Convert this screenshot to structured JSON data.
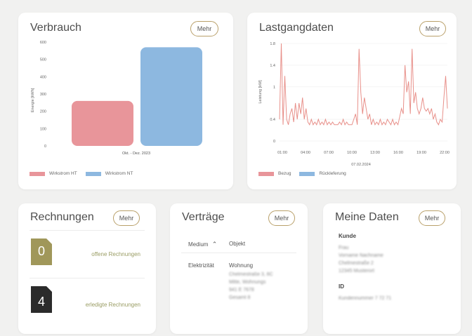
{
  "colors": {
    "accent": "#b9a06a",
    "ht": "#e8959a",
    "nt": "#8db8e0",
    "line": "#e8908a",
    "doc_open": "#a0975a",
    "doc_done": "#2b2b2b"
  },
  "verbrauch": {
    "title": "Verbrauch",
    "mehr": "Mehr",
    "chart_data": {
      "type": "bar",
      "categories": [
        "Okt. - Dez. 2023"
      ],
      "series": [
        {
          "name": "Wirkstrom HT",
          "values": [
            260
          ]
        },
        {
          "name": "Wirkstrom NT",
          "values": [
            570
          ]
        }
      ],
      "ylabel": "Energie [kWh]",
      "ylim": [
        0,
        600
      ],
      "yticks": [
        "0",
        "100",
        "200",
        "300",
        "400",
        "500",
        "600"
      ]
    }
  },
  "lastgang": {
    "title": "Lastgangdaten",
    "mehr": "Mehr",
    "chart_data": {
      "type": "line",
      "ylabel": "Leistung [kW]",
      "xlabel": "07.02.2024",
      "ylim": [
        0,
        1.8
      ],
      "yticks": [
        "0",
        "0.4",
        "1",
        "1.4",
        "1.8"
      ],
      "xticks": [
        "01:00",
        "04:00",
        "07:00",
        "10:00",
        "13:00",
        "16:00",
        "19:00",
        "22:00"
      ],
      "series": [
        {
          "name": "Bezug",
          "values": [
            0.4,
            1.8,
            0.3,
            1.2,
            0.4,
            0.3,
            0.5,
            0.6,
            0.35,
            0.7,
            0.4,
            0.7,
            0.5,
            0.8,
            0.4,
            0.6,
            0.35,
            0.3,
            0.4,
            0.3,
            0.35,
            0.3,
            0.4,
            0.3,
            0.35,
            0.3,
            0.4,
            0.3,
            0.35,
            0.3,
            0.35,
            0.3,
            0.3,
            0.3,
            0.35,
            0.3,
            0.4,
            0.3,
            0.35,
            0.3,
            0.3,
            0.3,
            0.4,
            0.5,
            0.3,
            1.7,
            0.9,
            0.5,
            0.8,
            0.6,
            0.4,
            0.5,
            0.3,
            0.4,
            0.3,
            0.35,
            0.3,
            0.4,
            0.3,
            0.35,
            0.3,
            0.4,
            0.35,
            0.3,
            0.4,
            0.3,
            0.35,
            0.3,
            0.45,
            0.6,
            0.5,
            1.4,
            0.9,
            1.1,
            0.5,
            1.7,
            0.7,
            0.9,
            0.6,
            0.5,
            0.6,
            0.8,
            0.6,
            0.55,
            0.6,
            0.5,
            0.6,
            0.4,
            0.5,
            0.35,
            0.3,
            0.4,
            0.35,
            0.8,
            1.2,
            0.6
          ]
        },
        {
          "name": "Rückleferung",
          "values": []
        }
      ]
    }
  },
  "rechnungen": {
    "title": "Rechnungen",
    "mehr": "Mehr",
    "open_count": "0",
    "open_label": "offene Rechnungen",
    "done_count": "4",
    "done_label": "erledigte Rechnungen"
  },
  "vertraege": {
    "title": "Verträge",
    "mehr": "Mehr",
    "col_medium": "Medium",
    "col_objekt": "Objekt",
    "row_medium": "Elektrizität",
    "row_objekt_line1": "Wohnung",
    "row_objekt_blurred": [
      "Chelmestraße 3, 8C",
      "Mitte, Wohnungs",
      "941 E 7678",
      "Gesamt 8"
    ]
  },
  "meine_daten": {
    "title": "Meine Daten",
    "mehr": "Mehr",
    "kunde_label": "Kunde",
    "kunde_blurred": [
      "Frau",
      "Vorname Nachname",
      "Chelmestraße 2",
      "12345 Musterort"
    ],
    "id_label": "ID",
    "id_blurred": "Kundennummer 7 72 71"
  }
}
